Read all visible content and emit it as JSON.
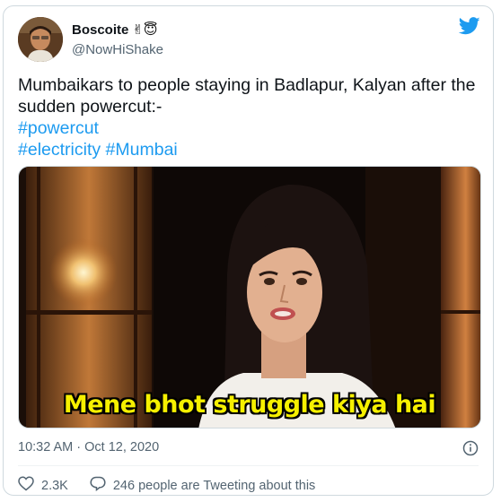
{
  "author": {
    "display_name": "Boscoite",
    "name_emojis": "✌😇",
    "handle": "@NowHiShake"
  },
  "tweet": {
    "lines": [
      "Mumbaikars to people staying in Badlapur, Kalyan after the",
      "sudden powercut:-"
    ],
    "hashtags_line1": [
      "#powercut"
    ],
    "hashtags_line2": [
      "#electricity",
      "#Mumbai"
    ]
  },
  "media": {
    "caption": "Mene bhot struggle kiya hai"
  },
  "meta": {
    "timestamp": "10:32 AM · Oct 12, 2020"
  },
  "actions": {
    "like_count": "2.3K",
    "conversation_text": "246 people are Tweeting about this"
  },
  "colors": {
    "link": "#1d9bf0",
    "text": "#0f1419",
    "secondary": "#536471",
    "caption": "#f6f000",
    "border": "#cfd9de"
  },
  "icons": [
    "twitter-bird-icon",
    "info-icon",
    "heart-icon",
    "speech-bubble-icon"
  ]
}
